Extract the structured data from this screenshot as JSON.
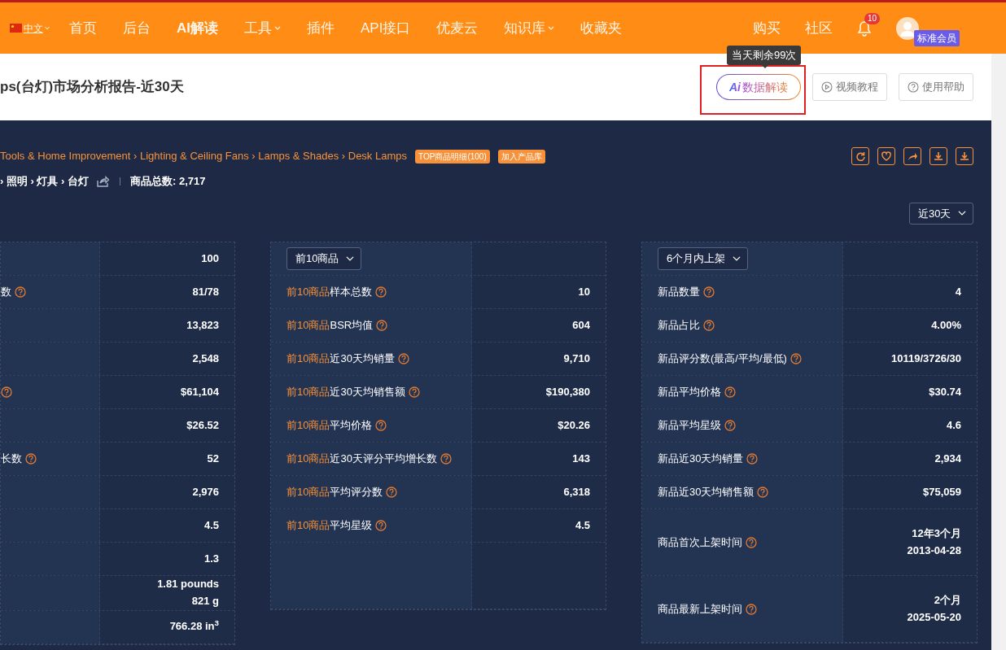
{
  "nav": {
    "language": {
      "label": "中文",
      "dropdown": true
    },
    "items": [
      {
        "label": "首页",
        "dropdown": false,
        "bold": false
      },
      {
        "label": "后台",
        "dropdown": false,
        "bold": false
      },
      {
        "label": "AI解读",
        "dropdown": false,
        "bold": true
      },
      {
        "label": "工具",
        "dropdown": true,
        "bold": false
      },
      {
        "label": "插件",
        "dropdown": false,
        "bold": false
      },
      {
        "label": "API接口",
        "dropdown": false,
        "bold": false
      },
      {
        "label": "优麦云",
        "dropdown": false,
        "bold": false
      },
      {
        "label": "知识库",
        "dropdown": true,
        "bold": false
      },
      {
        "label": "收藏夹",
        "dropdown": false,
        "bold": false
      }
    ],
    "right_items": [
      "购买",
      "社区"
    ],
    "notifications": "10",
    "member_badge": "标准会员"
  },
  "header": {
    "title": "ps(台灯)市场分析报告-近30天",
    "tooltip": "当天剩余99次",
    "ai_button": {
      "logo": "Ai",
      "label": "数据解读",
      "highlighted": true
    },
    "buttons": [
      {
        "label": "视频教程",
        "kind": "video"
      },
      {
        "label": "使用帮助",
        "kind": "help"
      }
    ]
  },
  "category": {
    "breadcrumb": "Tools & Home Improvement › Lighting & Ceiling Fans › Lamps & Shades › Desk Lamps",
    "tags": [
      "TOP商品明细(100)",
      "加入产品库"
    ],
    "cn_path": "› 照明 › 灯具 › 台灯",
    "total": "商品总数: 2,717"
  },
  "period": "近30天",
  "panels": [
    {
      "rows": [
        {
          "label": "",
          "help": false,
          "value": [
            "100"
          ]
        },
        {
          "label": "数",
          "help": true,
          "value": [
            "81/78"
          ]
        },
        {
          "label": "",
          "help": false,
          "value": [
            "13,823"
          ]
        },
        {
          "label": "",
          "help": false,
          "value": [
            "2,548"
          ]
        },
        {
          "label": "",
          "help": true,
          "value": [
            "$61,104"
          ]
        },
        {
          "label": "",
          "help": false,
          "value": [
            "$26.52"
          ]
        },
        {
          "label": "长数",
          "help": true,
          "value": [
            "52"
          ]
        },
        {
          "label": "",
          "help": false,
          "value": [
            "2,976"
          ]
        },
        {
          "label": "",
          "help": false,
          "value": [
            "4.5"
          ]
        },
        {
          "label": "",
          "help": false,
          "value": [
            "1.3"
          ]
        },
        {
          "label": "",
          "help": false,
          "value": [
            "1.81 pounds",
            "821 g"
          ]
        },
        {
          "label": "",
          "help": false,
          "value": [
            "766.28 in$^{3}$"
          ]
        }
      ]
    },
    {
      "select": "前10商品",
      "rows": [
        {
          "prefix": "前10商品",
          "label": "样本总数",
          "help": true,
          "value": [
            "10"
          ]
        },
        {
          "prefix": "前10商品",
          "label": "BSR均值",
          "help": true,
          "value": [
            "604"
          ]
        },
        {
          "prefix": "前10商品",
          "label": "近30天均销量",
          "help": true,
          "value": [
            "9,710"
          ]
        },
        {
          "prefix": "前10商品",
          "label": "近30天均销售额",
          "help": true,
          "value": [
            "$190,380"
          ]
        },
        {
          "prefix": "前10商品",
          "label": "平均价格",
          "help": true,
          "value": [
            "$20.26"
          ]
        },
        {
          "prefix": "前10商品",
          "label": "近30天评分平均增长数",
          "help": true,
          "value": [
            "143"
          ]
        },
        {
          "prefix": "前10商品",
          "label": "平均评分数",
          "help": true,
          "value": [
            "6,318"
          ]
        },
        {
          "prefix": "前10商品",
          "label": "平均星级",
          "help": true,
          "value": [
            "4.5"
          ]
        }
      ]
    },
    {
      "select": "6个月内上架",
      "rows": [
        {
          "label": "新品数量",
          "help": true,
          "value": [
            "4"
          ]
        },
        {
          "label": "新品占比",
          "help": true,
          "value": [
            "4.00%"
          ]
        },
        {
          "label": "新品评分数(最高/平均/最低)",
          "help": true,
          "value": [
            "10119/3726/30"
          ]
        },
        {
          "label": "新品平均价格",
          "help": true,
          "value": [
            "$30.74"
          ]
        },
        {
          "label": "新品平均星级",
          "help": true,
          "value": [
            "4.6"
          ]
        },
        {
          "label": "新品近30天均销量",
          "help": true,
          "value": [
            "2,934"
          ]
        },
        {
          "label": "新品近30天均销售额",
          "help": true,
          "value": [
            "$75,059"
          ]
        },
        {
          "label": "商品首次上架时间",
          "help": true,
          "value": [
            "12年3个月",
            "2013-04-28"
          ]
        },
        {
          "label": "商品最新上架时间",
          "help": true,
          "value": [
            "2个月",
            "2025-05-20"
          ]
        }
      ]
    }
  ]
}
